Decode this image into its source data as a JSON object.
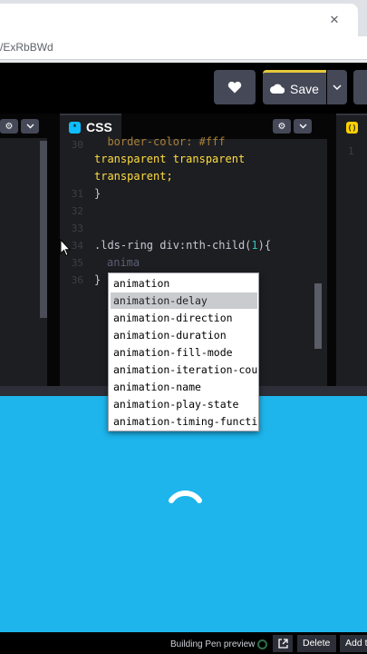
{
  "browser": {
    "url": "ExRbBWd",
    "url_prefix": "/"
  },
  "header": {
    "save_label": "Save"
  },
  "css_panel": {
    "title": "CSS",
    "badge": "*",
    "lines": [
      {
        "num": "30",
        "text": "  border-color: #fff"
      },
      {
        "num": "",
        "text": "transparent transparent"
      },
      {
        "num": "",
        "text": "transparent;"
      },
      {
        "num": "31",
        "text": "}"
      },
      {
        "num": "32",
        "text": ""
      },
      {
        "num": "33",
        "text": ""
      },
      {
        "num": "34",
        "text": ".lds-ring div:nth-child(1){"
      },
      {
        "num": "35",
        "text": "  anima"
      },
      {
        "num": "36",
        "text": "}"
      }
    ],
    "selector_part1": ".lds-ring div:nth-child(",
    "selector_num": "1",
    "selector_part2": "){",
    "typed": "anima",
    "close_brace": "}",
    "border_prop": "border-color: #fff",
    "line_transparent_1": "transparent transparent",
    "line_transparent_2": "transparent;"
  },
  "js_panel": {
    "badge": "( )",
    "line_num": "1"
  },
  "autocomplete": {
    "items": [
      "animation",
      "animation-delay",
      "animation-direction",
      "animation-duration",
      "animation-fill-mode",
      "animation-iteration-count",
      "animation-name",
      "animation-play-state",
      "animation-timing-function"
    ],
    "selected_index": 1
  },
  "footer": {
    "status": "Building Pen preview",
    "delete_label": "Delete",
    "add_label": "Add t"
  },
  "colors": {
    "preview_bg": "#1eb5ec",
    "accent_css": "#0ebeff",
    "accent_js": "#fcd000",
    "save_highlight": "#e6c93a"
  }
}
